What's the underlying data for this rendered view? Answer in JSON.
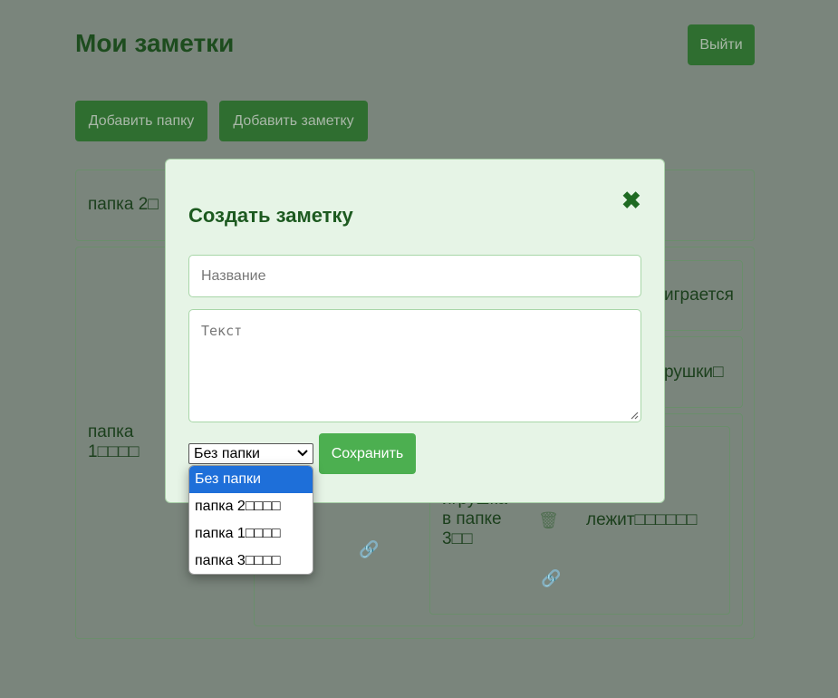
{
  "page": {
    "title": "Мои заметки",
    "logout_label": "Выйти",
    "add_folder_label": "Добавить папку",
    "add_note_label": "Добавить заметку"
  },
  "background": {
    "folder2_label": "папка 2□",
    "folder1_label": "папка 1□□□□",
    "fragment_a": "играется",
    "fragment_b": "рушки□",
    "fragment_c": "лежит□□□□□□",
    "fragment_d": "игрушка в папке 3□□",
    "fragment_e": "□□",
    "trash_icon": "🗑",
    "link_icon": "🔗"
  },
  "modal": {
    "title": "Создать заметку",
    "close_glyph": "✖",
    "title_placeholder": "Название",
    "text_placeholder": "Текст",
    "folder_select_value": "Без папки",
    "save_label": "Сохранить",
    "folder_options": [
      "Без папки",
      "папка 2□□□□",
      "папка 1□□□□",
      "папка 3□□□□"
    ]
  },
  "colors": {
    "accent": "#4caf50",
    "dark_green": "#1d5a20",
    "selected_option": "#1e6fd9"
  }
}
